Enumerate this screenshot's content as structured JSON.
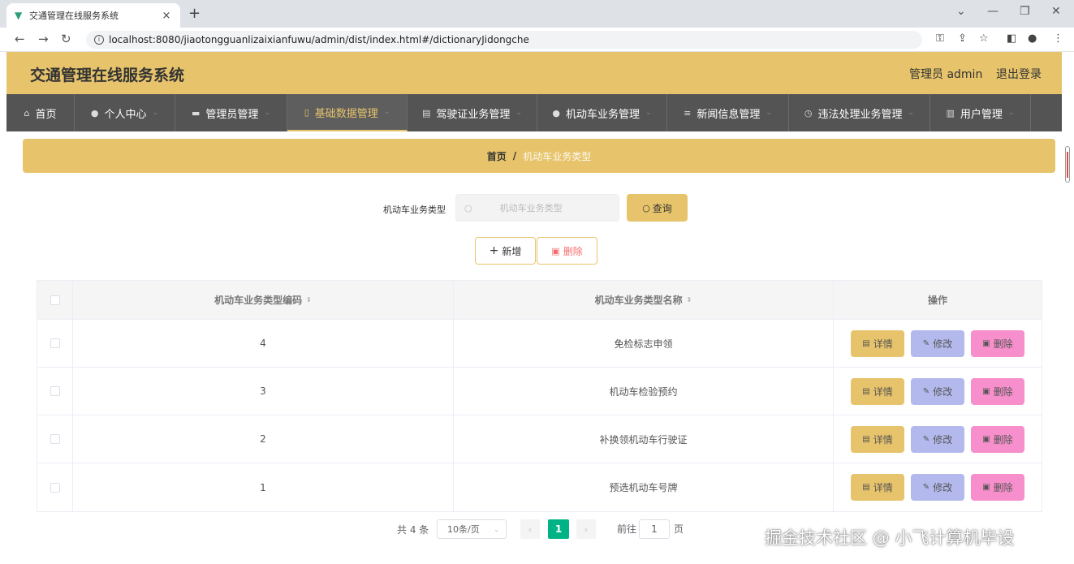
{
  "browser": {
    "tab_title": "交通管理在线服务系统",
    "tab_close": "×",
    "new_tab": "+",
    "url": "localhost:8080/jiaotongguanlizaixianfuwu/admin/dist/index.html#/dictionaryJidongche"
  },
  "header": {
    "title": "交通管理在线服务系统",
    "admin_label": "管理员 admin",
    "logout_label": "退出登录",
    "accent_color": "#e7c46b"
  },
  "nav": {
    "items": [
      {
        "label": "首页",
        "icon": "home-icon"
      },
      {
        "label": "个人中心",
        "icon": "user-icon"
      },
      {
        "label": "管理员管理",
        "icon": "admin-icon"
      },
      {
        "label": "基础数据管理",
        "icon": "data-icon",
        "active": true
      },
      {
        "label": "驾驶证业务管理",
        "icon": "clipboard-icon"
      },
      {
        "label": "机动车业务管理",
        "icon": "user-icon"
      },
      {
        "label": "新闻信息管理",
        "icon": "news-icon"
      },
      {
        "label": "违法处理业务管理",
        "icon": "clock-icon"
      },
      {
        "label": "用户管理",
        "icon": "chart-icon"
      }
    ]
  },
  "breadcrumb": {
    "home": "首页",
    "separator": "/",
    "current": "机动车业务类型"
  },
  "search": {
    "label": "机动车业务类型",
    "placeholder": "机动车业务类型",
    "query_button": "查询"
  },
  "actions": {
    "add_label": "新增",
    "delete_label": "删除"
  },
  "table": {
    "columns": [
      "机动车业务类型编码",
      "机动车业务类型名称",
      "操作"
    ],
    "rows": [
      {
        "code": "4",
        "name": "免检标志申领"
      },
      {
        "code": "3",
        "name": "机动车检验预约"
      },
      {
        "code": "2",
        "name": "补换领机动车行驶证"
      },
      {
        "code": "1",
        "name": "预选机动车号牌"
      }
    ],
    "row_actions": {
      "detail": "详情",
      "edit": "修改",
      "delete": "删除"
    }
  },
  "pagination": {
    "total": "共 4 条",
    "page_size": "10条/页",
    "current_page": "1",
    "goto_label": "前往",
    "goto_value": "1",
    "page_unit": "页"
  },
  "watermark": "掘金技术社区 @ 小飞计算机毕设"
}
